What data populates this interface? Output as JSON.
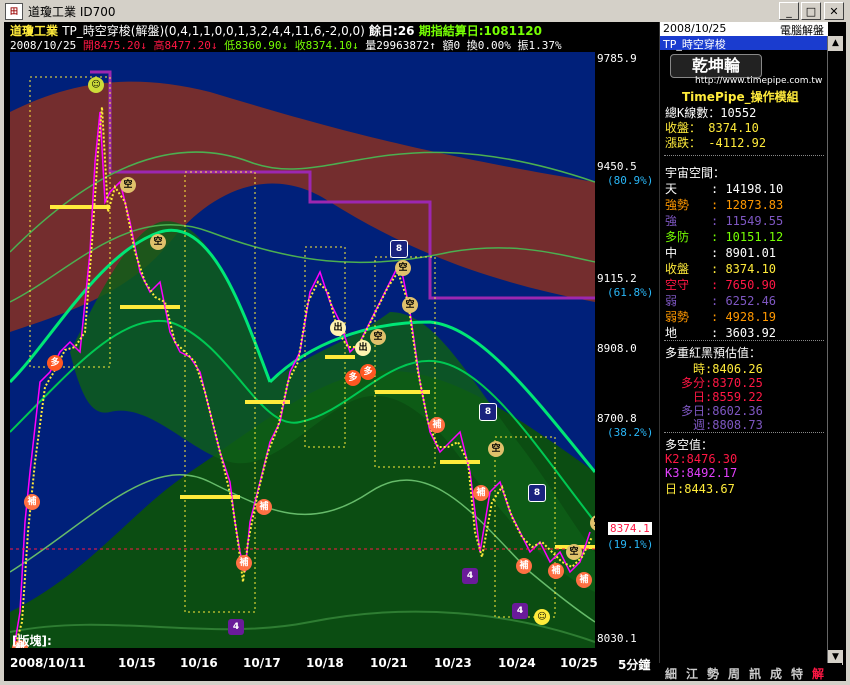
{
  "window": {
    "title": "道瓊工業 ID700",
    "icon": "app-icon"
  },
  "header": {
    "stock_name": "道瓊工業",
    "indicator": "TP_時空穿梭(解盤)(0,4,1,1,0,0,1,3,2,4,4,11,6,-2,0,0)",
    "remain": "餘日:26",
    "expiry": "期指結算日:1081120",
    "date": "2008/10/25",
    "open": "開8475.20",
    "high": "高8477.20",
    "low": "低8360.90",
    "close": "收8374.10",
    "volume": "量29963872",
    "amount": "額0",
    "turnover": "換0.00%",
    "amplitude": "振1.37%"
  },
  "axis": {
    "ticks": [
      {
        "label": "9785.9"
      },
      {
        "label": "9450.5"
      },
      {
        "label": "9115.2"
      },
      {
        "label": "8908.0"
      },
      {
        "label": "8700.8"
      },
      {
        "label": "8030.1"
      }
    ],
    "pct": [
      "(80.9%)",
      "(61.8%)",
      "(38.2%)",
      "(19.1%)"
    ],
    "current": "8374.1"
  },
  "chart_footer": {
    "label": "[版塊]:"
  },
  "xaxis": {
    "labels": [
      "2008/10/11",
      "10/15",
      "10/16",
      "10/17",
      "10/18",
      "10/21",
      "10/23",
      "10/24",
      "10/25"
    ],
    "period": "5分鐘"
  },
  "panel": {
    "date": "2008/10/25",
    "title": "電腦解盤",
    "subtitle": "TP_時空穿梭",
    "logo": "乾坤輪",
    "url": "http://www.timepipe.com.tw",
    "group": "TimePipe_操作模組",
    "stats": [
      {
        "label": "總K線數：",
        "value": "10552",
        "color": "#ffffff"
      },
      {
        "label": "收盤：",
        "value": "8374.10",
        "color": "#ffeb3b"
      },
      {
        "label": "漲跌：",
        "value": "-4112.92",
        "color": "#ffeb3b"
      }
    ],
    "space_title": "宇宙空間：",
    "levels": [
      {
        "label": "天",
        "value": "14198.10",
        "color": "#ffffff"
      },
      {
        "label": "強勢",
        "value": "12873.83",
        "color": "#ff9800"
      },
      {
        "label": "強",
        "value": "11549.55",
        "color": "#7e57c2"
      },
      {
        "label": "多防",
        "value": "10151.12",
        "color": "#76ff03"
      },
      {
        "label": "中",
        "value": "8901.01",
        "color": "#ffffff"
      },
      {
        "label": "收盤",
        "value": "8374.10",
        "color": "#ffeb3b"
      },
      {
        "label": "空守",
        "value": "7650.90",
        "color": "#ff1744"
      },
      {
        "label": "弱",
        "value": "6252.46",
        "color": "#7e57c2"
      },
      {
        "label": "弱勢",
        "value": "4928.19",
        "color": "#ff9800"
      },
      {
        "label": "地",
        "value": "3603.92",
        "color": "#ffffff"
      }
    ],
    "estimate_title": "多重紅黑預估值：",
    "estimates": [
      {
        "label": "時",
        "value": "8406.26",
        "color": "#ffeb3b"
      },
      {
        "label": "多分",
        "value": "8370.25",
        "color": "#ff1744"
      },
      {
        "label": "日",
        "value": "8559.22",
        "color": "#ff1744"
      },
      {
        "label": "多日",
        "value": "8602.36",
        "color": "#7e57c2"
      },
      {
        "label": "週",
        "value": "8808.73",
        "color": "#7e57c2"
      }
    ],
    "space_value_title": "多空值：",
    "space_values": [
      {
        "label": "K2:8476.30",
        "color": "#ff1744"
      },
      {
        "label": "K3:8492.17",
        "color": "#e040fb"
      },
      {
        "label": "日:8443.67",
        "color": "#ffeb3b"
      }
    ],
    "tabs": [
      "細",
      "江",
      "勢",
      "周",
      "訊",
      "成",
      "特",
      "解"
    ]
  },
  "signals": {
    "fill": "補",
    "short": "空",
    "long": "多",
    "out": "出",
    "eight": "8",
    "four": "4"
  }
}
